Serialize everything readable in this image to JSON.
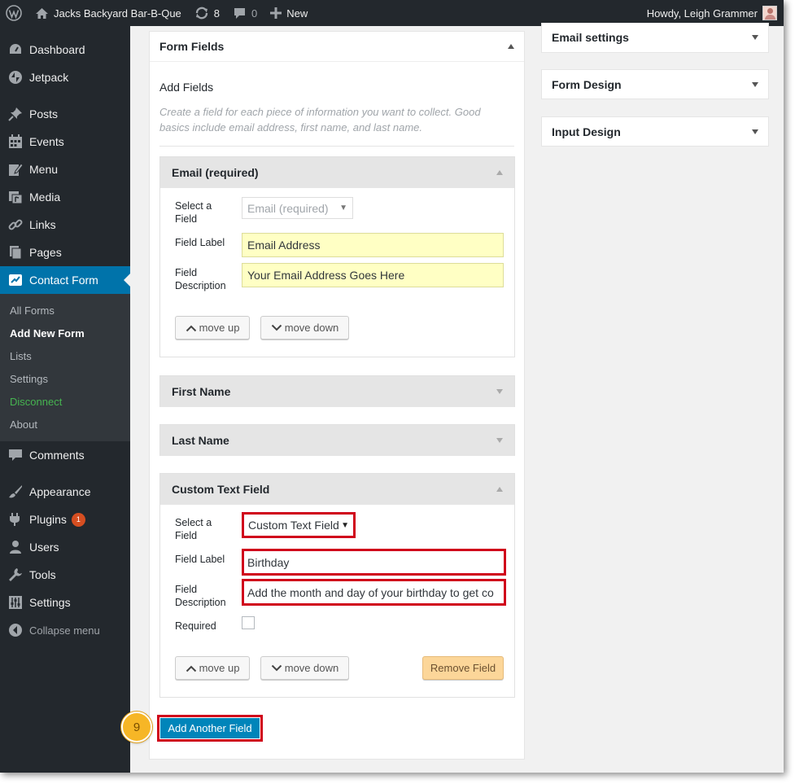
{
  "adminbar": {
    "site_name": "Jacks Backyard Bar-B-Que",
    "updates_count": "8",
    "comments_count": "0",
    "new_label": "New",
    "greeting": "Howdy, Leigh Grammer"
  },
  "sidebar": {
    "items": [
      {
        "label": "Dashboard",
        "icon": "dashboard-icon"
      },
      {
        "label": "Jetpack",
        "icon": "jetpack-icon"
      },
      {
        "label": "Posts",
        "icon": "pin-icon"
      },
      {
        "label": "Events",
        "icon": "calendar-icon"
      },
      {
        "label": "Menu",
        "icon": "edit-icon"
      },
      {
        "label": "Media",
        "icon": "media-icon"
      },
      {
        "label": "Links",
        "icon": "link-icon"
      },
      {
        "label": "Pages",
        "icon": "pages-icon"
      },
      {
        "label": "Contact Form",
        "icon": "contact-form-icon"
      }
    ],
    "submenu": [
      "All Forms",
      "Add New Form",
      "Lists",
      "Settings",
      "Disconnect",
      "About"
    ],
    "items_after": [
      {
        "label": "Comments",
        "icon": "comments-icon"
      },
      {
        "label": "Appearance",
        "icon": "brush-icon"
      },
      {
        "label": "Plugins",
        "icon": "plugin-icon",
        "badge": "1"
      },
      {
        "label": "Users",
        "icon": "users-icon"
      },
      {
        "label": "Tools",
        "icon": "wrench-icon"
      },
      {
        "label": "Settings",
        "icon": "settings-icon"
      }
    ],
    "collapse_label": "Collapse menu"
  },
  "form_fields": {
    "title": "Form Fields",
    "add_fields": "Add Fields",
    "hint": "Create a field for each piece of information you want to collect. Good basics include email address, first name, and last name."
  },
  "fields": {
    "email": {
      "title": "Email (required)",
      "select_label": "Select a Field",
      "select_value": "Email (required)",
      "label_label": "Field Label",
      "label_value": "Email Address",
      "desc_label": "Field Description",
      "desc_value": "Your Email Address Goes Here",
      "move_up": "move up",
      "move_down": "move down"
    },
    "first_name": {
      "title": "First Name"
    },
    "last_name": {
      "title": "Last Name"
    },
    "custom": {
      "title": "Custom Text Field",
      "select_label": "Select a Field",
      "select_value": "Custom Text Field",
      "label_label": "Field Label",
      "label_value": "Birthday",
      "desc_label": "Field Description",
      "desc_value": "Add the month and day of your birthday to get co",
      "required_label": "Required",
      "move_up": "move up",
      "move_down": "move down",
      "remove": "Remove Field"
    }
  },
  "add_another": "Add Another Field",
  "step_number": "9",
  "right": {
    "email_settings": "Email settings",
    "form_design": "Form Design",
    "input_design": "Input Design"
  },
  "colors": {
    "adminbar": "#23282d",
    "accent": "#0073aa",
    "highlight_red": "#d0021b",
    "button_primary": "#0085ba",
    "step_badge": "#f6b626"
  }
}
